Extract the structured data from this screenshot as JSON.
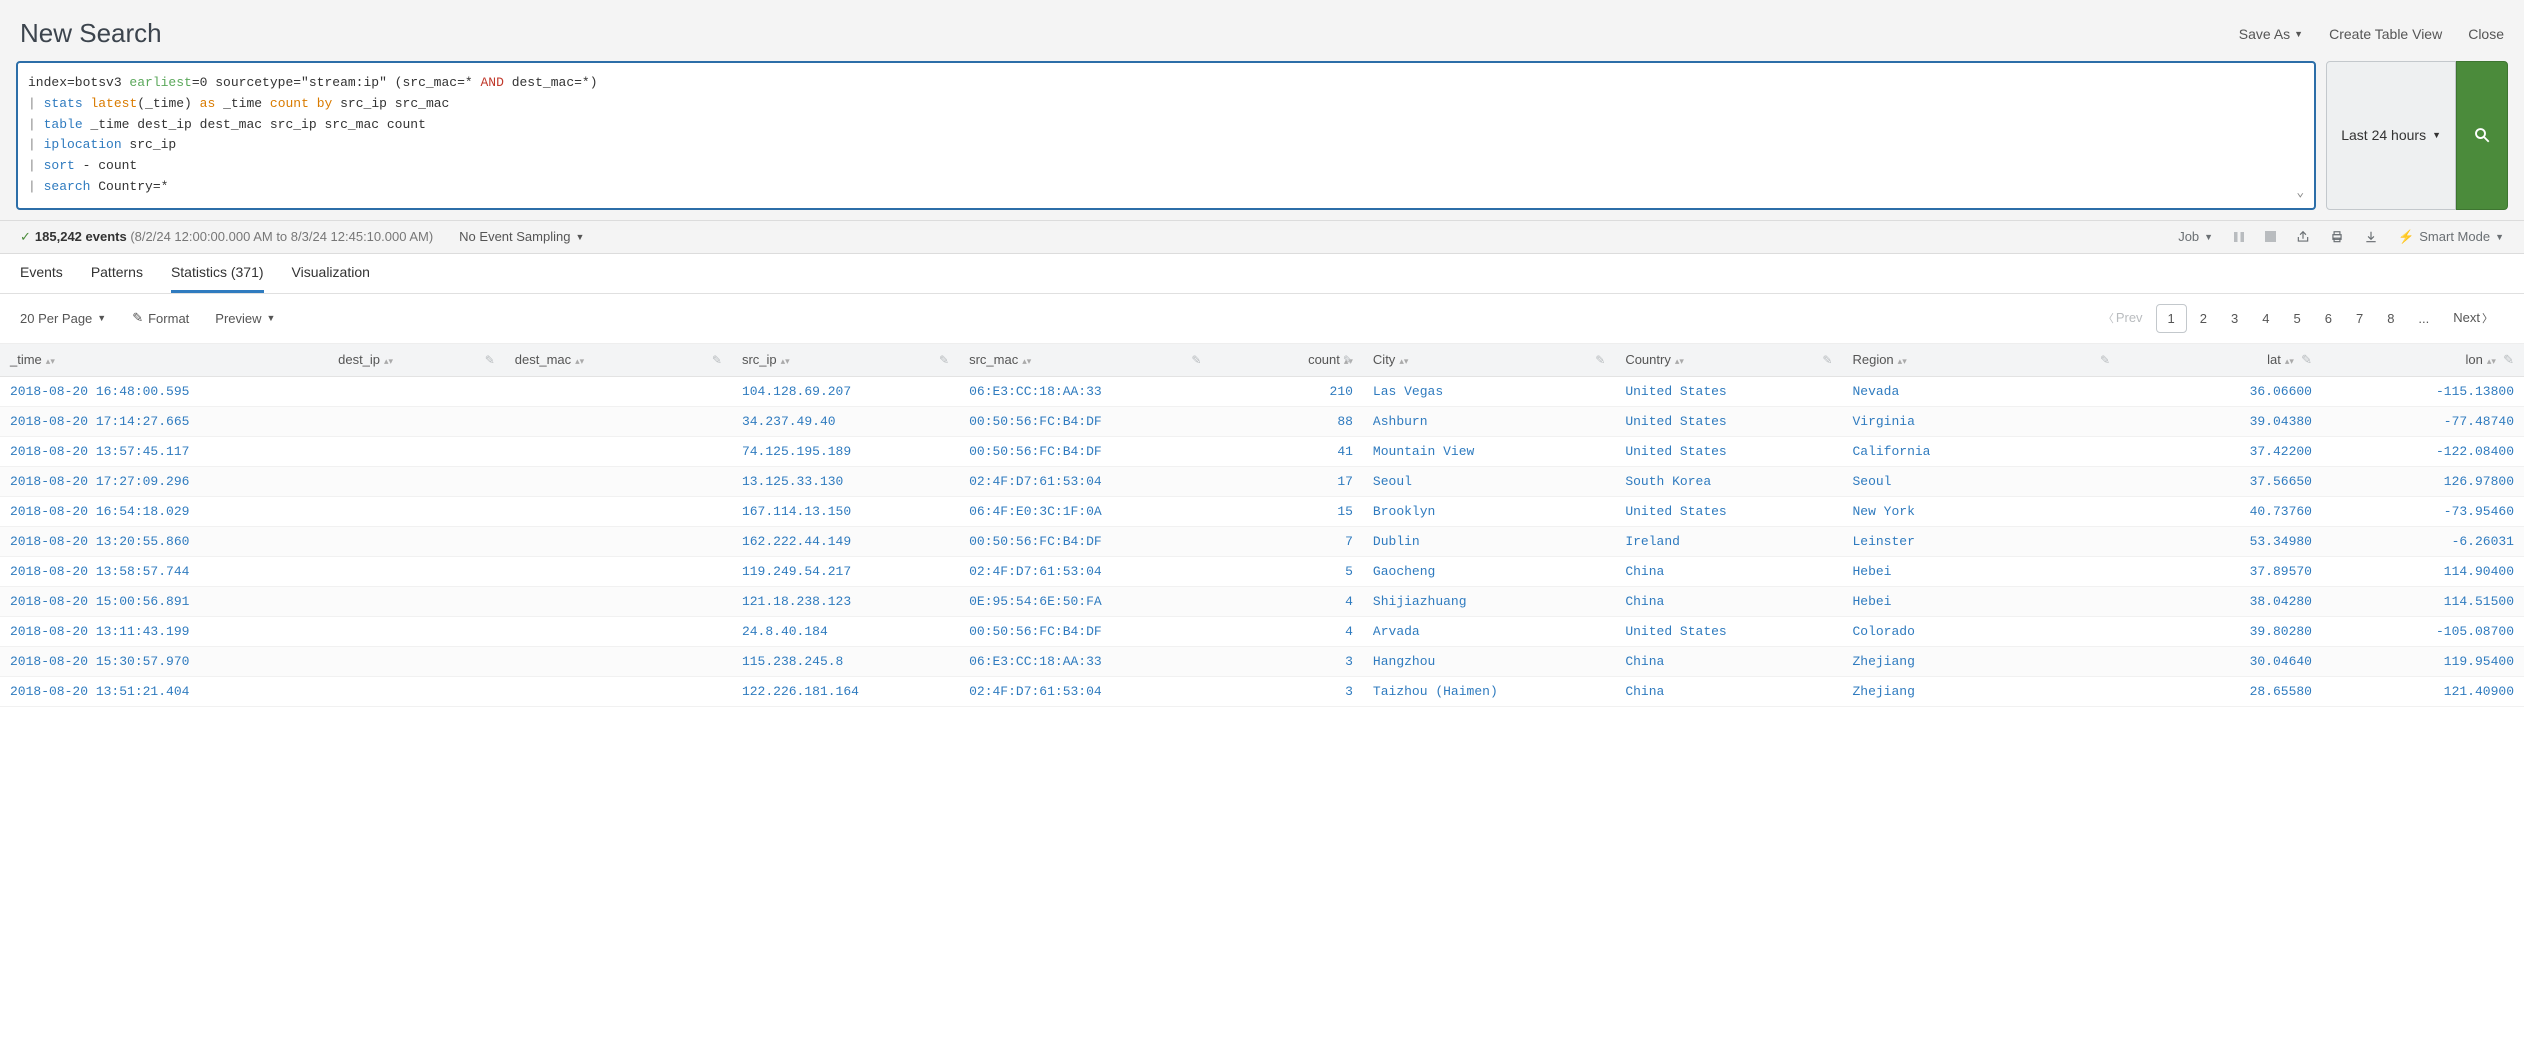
{
  "header": {
    "title": "New Search",
    "actions": {
      "save_as": "Save As",
      "create_table": "Create Table View",
      "close": "Close"
    }
  },
  "search": {
    "time_range": "Last 24 hours",
    "query_lines": {
      "l1a": "index=botsv3 ",
      "l1b": "earliest",
      "l1c": "=0 sourcetype=\"stream:ip\" (src_mac=* ",
      "l1d": "AND",
      "l1e": " dest_mac=*)",
      "l2a": "| ",
      "l2b": "stats",
      "l2c": " ",
      "l2d": "latest",
      "l2e": "(_time) ",
      "l2f": "as",
      "l2g": " _time ",
      "l2h": "count",
      "l2i": " ",
      "l2j": "by",
      "l2k": " src_ip src_mac",
      "l3a": "| ",
      "l3b": "table",
      "l3c": " _time dest_ip dest_mac src_ip src_mac count",
      "l4a": "| ",
      "l4b": "iplocation",
      "l4c": " src_ip",
      "l5a": "| ",
      "l5b": "sort",
      "l5c": " - count",
      "l6a": "| ",
      "l6b": "search",
      "l6c": " Country=*"
    }
  },
  "status": {
    "events_count": "185,242 events",
    "timerange_text": "(8/2/24 12:00:00.000 AM to 8/3/24 12:45:10.000 AM)",
    "sampling": "No Event Sampling",
    "job_label": "Job",
    "smart_mode": "Smart Mode"
  },
  "tabs": {
    "events": "Events",
    "patterns": "Patterns",
    "statistics": "Statistics (371)",
    "visualization": "Visualization"
  },
  "subbar": {
    "per_page": "20 Per Page",
    "format": "Format",
    "preview": "Preview"
  },
  "pager": {
    "prev": "Prev",
    "next": "Next",
    "pages": [
      "1",
      "2",
      "3",
      "4",
      "5",
      "6",
      "7",
      "8",
      "..."
    ]
  },
  "columns": {
    "time": "_time",
    "dest_ip": "dest_ip",
    "dest_mac": "dest_mac",
    "src_ip": "src_ip",
    "src_mac": "src_mac",
    "count": "count",
    "city": "City",
    "country": "Country",
    "region": "Region",
    "lat": "lat",
    "lon": "lon"
  },
  "rows": [
    {
      "time": "2018-08-20 16:48:00.595",
      "dest_ip": "",
      "dest_mac": "",
      "src_ip": "104.128.69.207",
      "src_mac": "06:E3:CC:18:AA:33",
      "count": "210",
      "city": "Las Vegas",
      "country": "United States",
      "region": "Nevada",
      "lat": "36.06600",
      "lon": "-115.13800"
    },
    {
      "time": "2018-08-20 17:14:27.665",
      "dest_ip": "",
      "dest_mac": "",
      "src_ip": "34.237.49.40",
      "src_mac": "00:50:56:FC:B4:DF",
      "count": "88",
      "city": "Ashburn",
      "country": "United States",
      "region": "Virginia",
      "lat": "39.04380",
      "lon": "-77.48740"
    },
    {
      "time": "2018-08-20 13:57:45.117",
      "dest_ip": "",
      "dest_mac": "",
      "src_ip": "74.125.195.189",
      "src_mac": "00:50:56:FC:B4:DF",
      "count": "41",
      "city": "Mountain View",
      "country": "United States",
      "region": "California",
      "lat": "37.42200",
      "lon": "-122.08400"
    },
    {
      "time": "2018-08-20 17:27:09.296",
      "dest_ip": "",
      "dest_mac": "",
      "src_ip": "13.125.33.130",
      "src_mac": "02:4F:D7:61:53:04",
      "count": "17",
      "city": "Seoul",
      "country": "South Korea",
      "region": "Seoul",
      "lat": "37.56650",
      "lon": "126.97800"
    },
    {
      "time": "2018-08-20 16:54:18.029",
      "dest_ip": "",
      "dest_mac": "",
      "src_ip": "167.114.13.150",
      "src_mac": "06:4F:E0:3C:1F:0A",
      "count": "15",
      "city": "Brooklyn",
      "country": "United States",
      "region": "New York",
      "lat": "40.73760",
      "lon": "-73.95460"
    },
    {
      "time": "2018-08-20 13:20:55.860",
      "dest_ip": "",
      "dest_mac": "",
      "src_ip": "162.222.44.149",
      "src_mac": "00:50:56:FC:B4:DF",
      "count": "7",
      "city": "Dublin",
      "country": "Ireland",
      "region": "Leinster",
      "lat": "53.34980",
      "lon": "-6.26031"
    },
    {
      "time": "2018-08-20 13:58:57.744",
      "dest_ip": "",
      "dest_mac": "",
      "src_ip": "119.249.54.217",
      "src_mac": "02:4F:D7:61:53:04",
      "count": "5",
      "city": "Gaocheng",
      "country": "China",
      "region": "Hebei",
      "lat": "37.89570",
      "lon": "114.90400"
    },
    {
      "time": "2018-08-20 15:00:56.891",
      "dest_ip": "",
      "dest_mac": "",
      "src_ip": "121.18.238.123",
      "src_mac": "0E:95:54:6E:50:FA",
      "count": "4",
      "city": "Shijiazhuang",
      "country": "China",
      "region": "Hebei",
      "lat": "38.04280",
      "lon": "114.51500"
    },
    {
      "time": "2018-08-20 13:11:43.199",
      "dest_ip": "",
      "dest_mac": "",
      "src_ip": "24.8.40.184",
      "src_mac": "00:50:56:FC:B4:DF",
      "count": "4",
      "city": "Arvada",
      "country": "United States",
      "region": "Colorado",
      "lat": "39.80280",
      "lon": "-105.08700"
    },
    {
      "time": "2018-08-20 15:30:57.970",
      "dest_ip": "",
      "dest_mac": "",
      "src_ip": "115.238.245.8",
      "src_mac": "06:E3:CC:18:AA:33",
      "count": "3",
      "city": "Hangzhou",
      "country": "China",
      "region": "Zhejiang",
      "lat": "30.04640",
      "lon": "119.95400"
    },
    {
      "time": "2018-08-20 13:51:21.404",
      "dest_ip": "",
      "dest_mac": "",
      "src_ip": "122.226.181.164",
      "src_mac": "02:4F:D7:61:53:04",
      "count": "3",
      "city": "Taizhou (Haimen)",
      "country": "China",
      "region": "Zhejiang",
      "lat": "28.65580",
      "lon": "121.40900"
    }
  ]
}
